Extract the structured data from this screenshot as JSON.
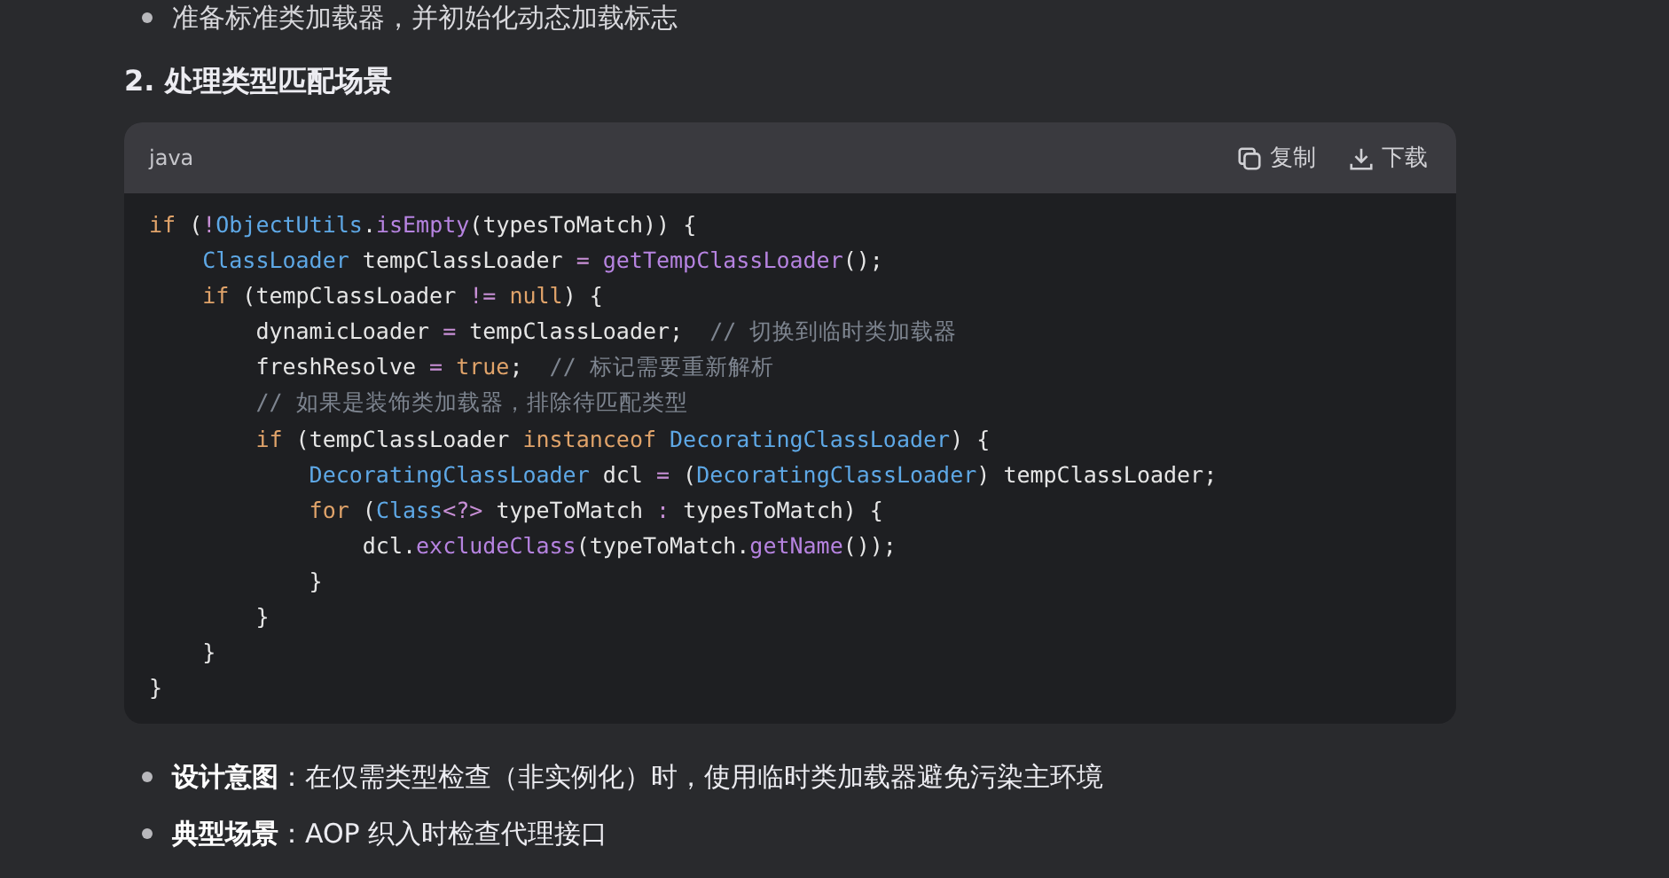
{
  "top_bullet": "准备标准类加载器，并初始化动态加载标志",
  "heading": "2. 处理类型匹配场景",
  "code_block": {
    "language": "java",
    "copy_label": "复制",
    "download_label": "下载",
    "lines": [
      [
        {
          "kind": "kw",
          "text": "if"
        },
        {
          "kind": "plain",
          "text": " ("
        },
        {
          "kind": "op",
          "text": "!"
        },
        {
          "kind": "type",
          "text": "ObjectUtils"
        },
        {
          "kind": "plain",
          "text": "."
        },
        {
          "kind": "fn",
          "text": "isEmpty"
        },
        {
          "kind": "plain",
          "text": "(typesToMatch)) {"
        }
      ],
      [
        {
          "kind": "type",
          "text": "    ClassLoader"
        },
        {
          "kind": "plain",
          "text": " tempClassLoader "
        },
        {
          "kind": "op",
          "text": "="
        },
        {
          "kind": "fn",
          "text": " getTempClassLoader"
        },
        {
          "kind": "plain",
          "text": "();"
        }
      ],
      [
        {
          "kind": "kw",
          "text": "    if"
        },
        {
          "kind": "plain",
          "text": " (tempClassLoader "
        },
        {
          "kind": "op",
          "text": "!="
        },
        {
          "kind": "kw",
          "text": " null"
        },
        {
          "kind": "plain",
          "text": ") {"
        }
      ],
      [
        {
          "kind": "plain",
          "text": "        dynamicLoader "
        },
        {
          "kind": "op",
          "text": "="
        },
        {
          "kind": "plain",
          "text": " tempClassLoader;  "
        },
        {
          "kind": "comment",
          "text": "// 切换到临时类加载器"
        }
      ],
      [
        {
          "kind": "plain",
          "text": "        freshResolve "
        },
        {
          "kind": "op",
          "text": "="
        },
        {
          "kind": "kw",
          "text": " true"
        },
        {
          "kind": "plain",
          "text": ";  "
        },
        {
          "kind": "comment",
          "text": "// 标记需要重新解析"
        }
      ],
      [
        {
          "kind": "comment",
          "text": "        // 如果是装饰类加载器，排除待匹配类型"
        }
      ],
      [
        {
          "kind": "kw",
          "text": "        if"
        },
        {
          "kind": "plain",
          "text": " (tempClassLoader "
        },
        {
          "kind": "kw",
          "text": "instanceof"
        },
        {
          "kind": "type",
          "text": " DecoratingClassLoader"
        },
        {
          "kind": "plain",
          "text": ") {"
        }
      ],
      [
        {
          "kind": "type",
          "text": "            DecoratingClassLoader"
        },
        {
          "kind": "plain",
          "text": " dcl "
        },
        {
          "kind": "op",
          "text": "="
        },
        {
          "kind": "plain",
          "text": " ("
        },
        {
          "kind": "type",
          "text": "DecoratingClassLoader"
        },
        {
          "kind": "plain",
          "text": ") tempClassLoader;"
        }
      ],
      [
        {
          "kind": "kw",
          "text": "            for"
        },
        {
          "kind": "plain",
          "text": " ("
        },
        {
          "kind": "type",
          "text": "Class"
        },
        {
          "kind": "op",
          "text": "<?>"
        },
        {
          "kind": "plain",
          "text": " typeToMatch "
        },
        {
          "kind": "op",
          "text": ":"
        },
        {
          "kind": "plain",
          "text": " typesToMatch) {"
        }
      ],
      [
        {
          "kind": "plain",
          "text": "                dcl."
        },
        {
          "kind": "fn",
          "text": "excludeClass"
        },
        {
          "kind": "plain",
          "text": "(typeToMatch."
        },
        {
          "kind": "fn",
          "text": "getName"
        },
        {
          "kind": "plain",
          "text": "());"
        }
      ],
      [
        {
          "kind": "plain",
          "text": "            }"
        }
      ],
      [
        {
          "kind": "plain",
          "text": "        }"
        }
      ],
      [
        {
          "kind": "plain",
          "text": "    }"
        }
      ],
      [
        {
          "kind": "plain",
          "text": "}"
        }
      ]
    ]
  },
  "bullets": [
    {
      "term": "设计意图",
      "text": "：在仅需类型检查（非实例化）时，使用临时类加载器避免污染主环境"
    },
    {
      "term": "典型场景",
      "text": "：AOP 织入时检查代理接口"
    }
  ]
}
